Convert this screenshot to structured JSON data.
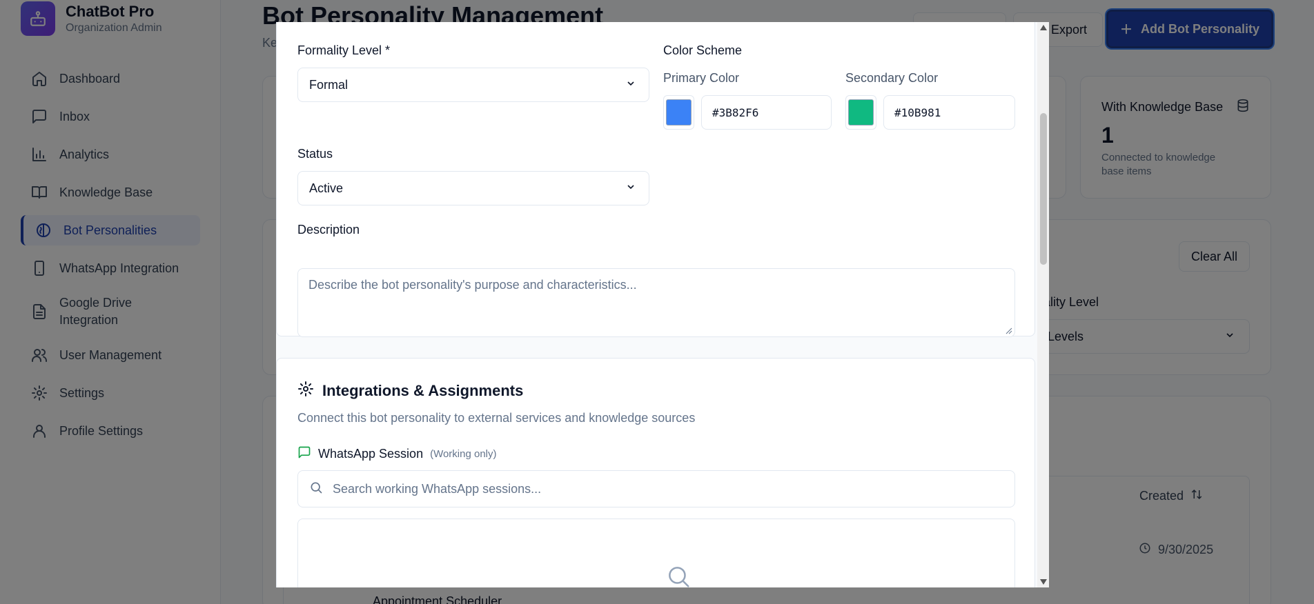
{
  "app": {
    "name": "ChatBot Pro",
    "role": "Organization Admin"
  },
  "sidebar": {
    "items": [
      {
        "label": "Dashboard",
        "icon": "home-icon"
      },
      {
        "label": "Inbox",
        "icon": "message-square-icon"
      },
      {
        "label": "Analytics",
        "icon": "bar-chart-icon"
      },
      {
        "label": "Knowledge Base",
        "icon": "book-open-icon"
      },
      {
        "label": "Bot Personalities",
        "icon": "brain-icon",
        "active": true
      },
      {
        "label": "WhatsApp Integration",
        "icon": "smartphone-icon"
      },
      {
        "label": "Google Drive Integration",
        "icon": "file-text-icon"
      },
      {
        "label": "User Management",
        "icon": "users-icon"
      },
      {
        "label": "Settings",
        "icon": "gear-icon"
      },
      {
        "label": "Profile Settings",
        "icon": "user-icon"
      }
    ]
  },
  "page": {
    "title": "Bot Personality Management",
    "subtitle": "Ke",
    "export_label": "Export",
    "add_label": "Add Bot Personality"
  },
  "stats": {
    "knowledge": {
      "title": "With Knowledge Base",
      "value": "1",
      "desc": "Connected to knowledge base items"
    }
  },
  "filters": {
    "clear_label": "Clear All",
    "formality_label": "ality Level",
    "formality_value": "Levels"
  },
  "table": {
    "created_header": "Created",
    "row1_date": "9/30/2025",
    "row2_name": "Appointment Scheduler"
  },
  "modal": {
    "formality": {
      "label": "Formality Level *",
      "value": "Formal"
    },
    "color_scheme": {
      "label": "Color Scheme",
      "primary_label": "Primary Color",
      "primary_value": "#3B82F6",
      "secondary_label": "Secondary Color",
      "secondary_value": "#10B981"
    },
    "status": {
      "label": "Status",
      "value": "Active"
    },
    "description": {
      "label": "Description",
      "placeholder": "Describe the bot personality's purpose and characteristics..."
    },
    "integrations": {
      "title": "Integrations & Assignments",
      "desc": "Connect this bot personality to external services and knowledge sources",
      "whatsapp_label": "WhatsApp Session",
      "whatsapp_hint": "(Working only)",
      "search_placeholder": "Search working WhatsApp sessions..."
    }
  },
  "colors": {
    "accent": "#1e40af",
    "primary": "#3B82F6",
    "secondary": "#10B981",
    "whatsapp": "#16a34a"
  }
}
